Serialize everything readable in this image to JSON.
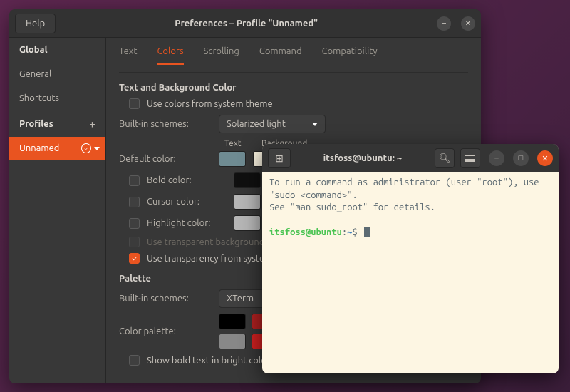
{
  "prefs": {
    "help": "Help",
    "title": "Preferences – Profile \"Unnamed\"",
    "sidebar": {
      "global": "Global",
      "general": "General",
      "shortcuts": "Shortcuts",
      "profiles": "Profiles",
      "selected": "Unnamed"
    },
    "tabs": [
      "Text",
      "Colors",
      "Scrolling",
      "Command",
      "Compatibility"
    ],
    "active_tab": "Colors",
    "section_textbg": "Text and Background Color",
    "use_system": "Use colors from system theme",
    "builtin_label": "Built-in schemes:",
    "builtin_value": "Solarized light",
    "col_text": "Text",
    "col_bg": "Background",
    "default_color": "Default color:",
    "bold_color": "Bold color:",
    "cursor_color": "Cursor color:",
    "highlight_color": "Highlight color:",
    "transparent_bg": "Use transparent background",
    "transparency_system": "Use transparency from system theme",
    "section_palette": "Palette",
    "palette_scheme_label": "Built-in schemes:",
    "palette_scheme_value": "XTerm",
    "palette_label": "Color palette:",
    "show_bold": "Show bold text in bright colors",
    "swatches": {
      "default_text": "#6F8B92",
      "default_bg": "#FDF6E3",
      "bold_text": "#101010",
      "bold_bg": "#131313",
      "cursor_text": "#B6B6B6",
      "cursor_bg": "#1A1A1A",
      "hl_text": "#B6B6B6",
      "hl_bg": "#1A1A1A",
      "p1": "#000000",
      "p2": "#B02020",
      "p3": "#888888",
      "p4": "#D02020"
    }
  },
  "terminal": {
    "title": "itsfoss@ubuntu: ~",
    "line1": "To run a command as administrator (user \"root\"), use \"sudo <command>\".",
    "line2": "See \"man sudo_root\" for details.",
    "prompt_user": "itsfoss@ubuntu",
    "prompt_sep": ":",
    "prompt_path": "~",
    "prompt_end": "$"
  }
}
